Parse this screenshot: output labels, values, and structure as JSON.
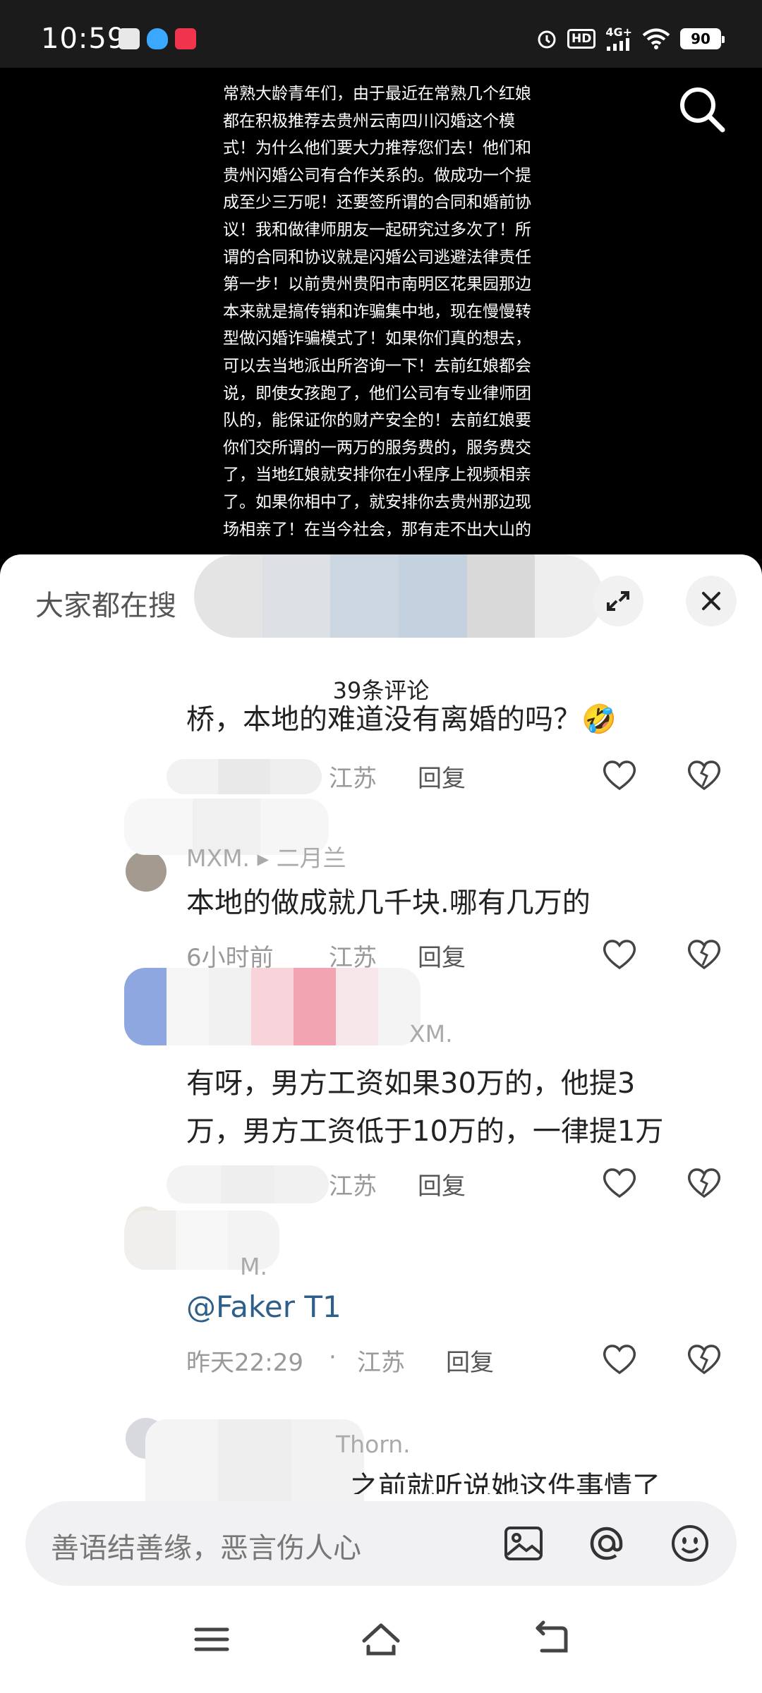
{
  "status": {
    "time": "10:59",
    "hd": "HD",
    "network": "4G+",
    "battery": "90",
    "app_icon_colors": [
      "#e8e8e8",
      "#3aa8ff",
      "#f0344e"
    ]
  },
  "video": {
    "description": "常熟大龄青年们，由于最近在常熟几个红娘都在积极推荐去贵州云南四川闪婚这个模式！为什么他们要大力推荐您们去！他们和贵州闪婚公司有合作关系的。做成功一个提成至少三万呢！还要签所谓的合同和婚前协议！我和做律师朋友一起研究过多次了！所谓的合同和协议就是闪婚公司逃避法律责任第一步！以前贵州贵阳市南明区花果园那边本来就是搞传销和诈骗集中地，现在慢慢转型做闪婚诈骗模式了！如果你们真的想去，可以去当地派出所咨询一下！去前红娘都会说，即使女孩跑了，他们公司有专业律师团队的，能保证你的财产安全的！去前红娘要你们交所谓的一两万的服务费的，服务费交了，当地红娘就安排你在小程序上视频相亲了。如果你相中了，就安排你去贵州那边现场相亲了！在当今社会，那有走不出大山的",
    "search_icon": "search-icon"
  },
  "sheet": {
    "trending_label": "大家都在搜",
    "comment_count": "39条评论",
    "expand_icon": "expand-icon",
    "close_icon": "close-icon"
  },
  "comments": [
    {
      "text": "桥，本地的难道没有离婚的吗？🤣",
      "time": "",
      "location": "江苏",
      "reply": "回复"
    },
    {
      "author": "MXM. ▸ 二月兰",
      "text": "本地的做成就几千块.哪有几万的",
      "time": "6小时前",
      "location": "江苏",
      "reply": "回复"
    },
    {
      "author": "XM.",
      "text_line1": "有呀，男方工资如果30万的，他提3",
      "text_line2": "万，男方工资低于10万的，一律提1万",
      "location": "江苏",
      "reply": "回复"
    },
    {
      "author": "M.",
      "mention": "@Faker T1",
      "time": "昨天22:29",
      "dot": "·",
      "location": "江苏",
      "reply": "回复"
    },
    {
      "author": "Thorn.",
      "text": "之前就听说她这件事情了"
    }
  ],
  "input": {
    "placeholder": "善语结善缘，恶言伤人心",
    "icons": [
      "image-icon",
      "at-icon",
      "emoji-icon"
    ]
  },
  "nav": {
    "icons": [
      "menu-icon",
      "home-icon",
      "back-icon"
    ]
  }
}
